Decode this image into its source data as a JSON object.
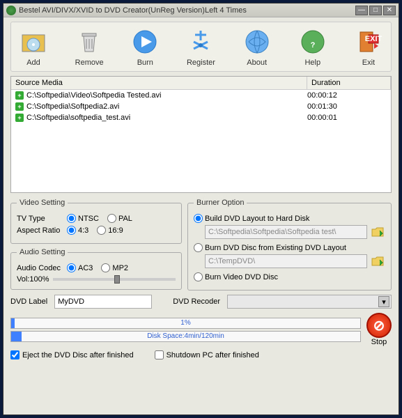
{
  "titlebar": {
    "title": "Bestel AVI/DIVX/XVID to DVD Creator(UnReg Version)Left 4 Times"
  },
  "toolbar": {
    "add": "Add",
    "remove": "Remove",
    "burn": "Burn",
    "register": "Register",
    "about": "About",
    "help": "Help",
    "exit": "Exit"
  },
  "media": {
    "header_source": "Source Media",
    "header_duration": "Duration",
    "rows": [
      {
        "path": "C:\\Softpedia\\Video\\Softpedia Tested.avi",
        "duration": "00:00:12"
      },
      {
        "path": "C:\\Softpedia\\Softpedia2.avi",
        "duration": "00:01:30"
      },
      {
        "path": "C:\\Softpedia\\softpedia_test.avi",
        "duration": "00:00:01"
      }
    ]
  },
  "video_setting": {
    "legend": "Video Setting",
    "tv_type_label": "TV Type",
    "tv_type_ntsc": "NTSC",
    "tv_type_pal": "PAL",
    "aspect_label": "Aspect Ratio",
    "aspect_43": "4:3",
    "aspect_169": "16:9"
  },
  "audio_setting": {
    "legend": "Audio Setting",
    "codec_label": "Audio Codec",
    "codec_ac3": "AC3",
    "codec_mp2": "MP2",
    "vol_label": "Vol:100%"
  },
  "burner": {
    "legend": "Burner Option",
    "opt1": "Build DVD Layout to Hard Disk",
    "path1": "C:\\Softpedia\\Softpedia\\Softpedia test\\",
    "opt2": "Burn DVD Disc from Existing DVD Layout",
    "path2": "C:\\TempDVD\\",
    "opt3": "Burn Video DVD Disc"
  },
  "dvd_label": {
    "label": "DVD Label",
    "value": "MyDVD"
  },
  "recorder": {
    "label": "DVD Recoder"
  },
  "progress": {
    "percent": "1%",
    "disk_space": "Disk Space:4min/120min"
  },
  "stop": "Stop",
  "checks": {
    "eject": "Eject the DVD Disc after finished",
    "shutdown": "Shutdown PC after finished"
  }
}
